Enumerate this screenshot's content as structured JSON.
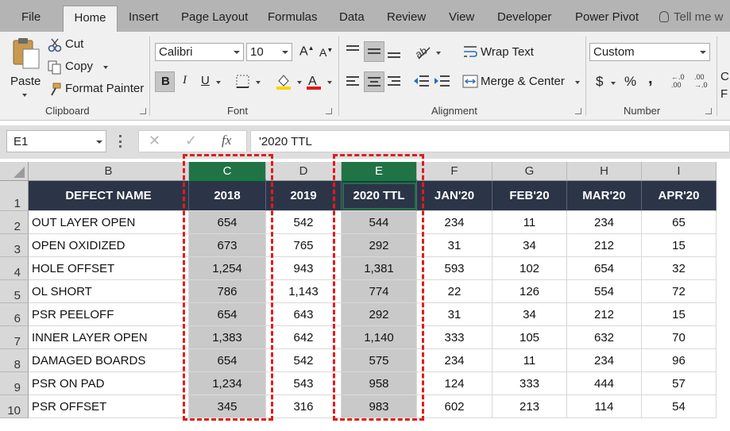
{
  "tabs": {
    "file": "File",
    "home": "Home",
    "insert": "Insert",
    "page_layout": "Page Layout",
    "formulas": "Formulas",
    "data": "Data",
    "review": "Review",
    "view": "View",
    "developer": "Developer",
    "power_pivot": "Power Pivot",
    "tell_me": "Tell me w"
  },
  "clipboard": {
    "paste": "Paste",
    "cut": "Cut",
    "copy": "Copy",
    "format_painter": "Format Painter",
    "label": "Clipboard"
  },
  "font": {
    "name": "Calibri",
    "size": "10",
    "bold": "B",
    "italic": "I",
    "underline": "U",
    "grow": "A",
    "shrink": "A",
    "label": "Font"
  },
  "alignment": {
    "wrap_text": "Wrap Text",
    "merge_center": "Merge & Center",
    "label": "Alignment"
  },
  "number": {
    "format": "Custom",
    "currency": "$",
    "percent": "%",
    "comma": ",",
    "label": "Number",
    "inc_decimal_top": "←.0",
    "inc_decimal_bottom": ".00",
    "dec_decimal_top": ".00",
    "dec_decimal_bottom": "→.0",
    "cut_off_1": "C",
    "cut_off_2": "F"
  },
  "formula_bar": {
    "name_box": "E1",
    "fx": "fx",
    "content": "'2020 TTL"
  },
  "columns": [
    "B",
    "C",
    "D",
    "E",
    "F",
    "G",
    "H",
    "I"
  ],
  "rows": [
    "1",
    "2",
    "3",
    "4",
    "5",
    "6",
    "7",
    "8",
    "9",
    "10"
  ],
  "table": {
    "headers": [
      "DEFECT NAME",
      "2018",
      "2019",
      "2020 TTL",
      "JAN'20",
      "FEB'20",
      "MAR'20",
      "APR'20"
    ],
    "data": [
      [
        "OUT LAYER OPEN",
        "654",
        "542",
        "544",
        "234",
        "11",
        "234",
        "65"
      ],
      [
        "OPEN OXIDIZED",
        "673",
        "765",
        "292",
        "31",
        "34",
        "212",
        "15"
      ],
      [
        "HOLE OFFSET",
        "1,254",
        "943",
        "1,381",
        "593",
        "102",
        "654",
        "32"
      ],
      [
        "OL SHORT",
        "786",
        "1,143",
        "774",
        "22",
        "126",
        "554",
        "72"
      ],
      [
        "PSR PEELOFF",
        "654",
        "643",
        "292",
        "31",
        "34",
        "212",
        "15"
      ],
      [
        "INNER LAYER OPEN",
        "1,383",
        "642",
        "1,140",
        "333",
        "105",
        "632",
        "70"
      ],
      [
        "DAMAGED BOARDS",
        "654",
        "542",
        "575",
        "234",
        "11",
        "234",
        "96"
      ],
      [
        "PSR ON PAD",
        "1,234",
        "543",
        "958",
        "124",
        "333",
        "444",
        "57"
      ],
      [
        "PSR OFFSET",
        "345",
        "316",
        "983",
        "602",
        "213",
        "114",
        "54"
      ]
    ]
  },
  "colors": {
    "selection_green": "#217346",
    "header_fill": "#2b3547",
    "highlight_red": "#e21b1b"
  }
}
